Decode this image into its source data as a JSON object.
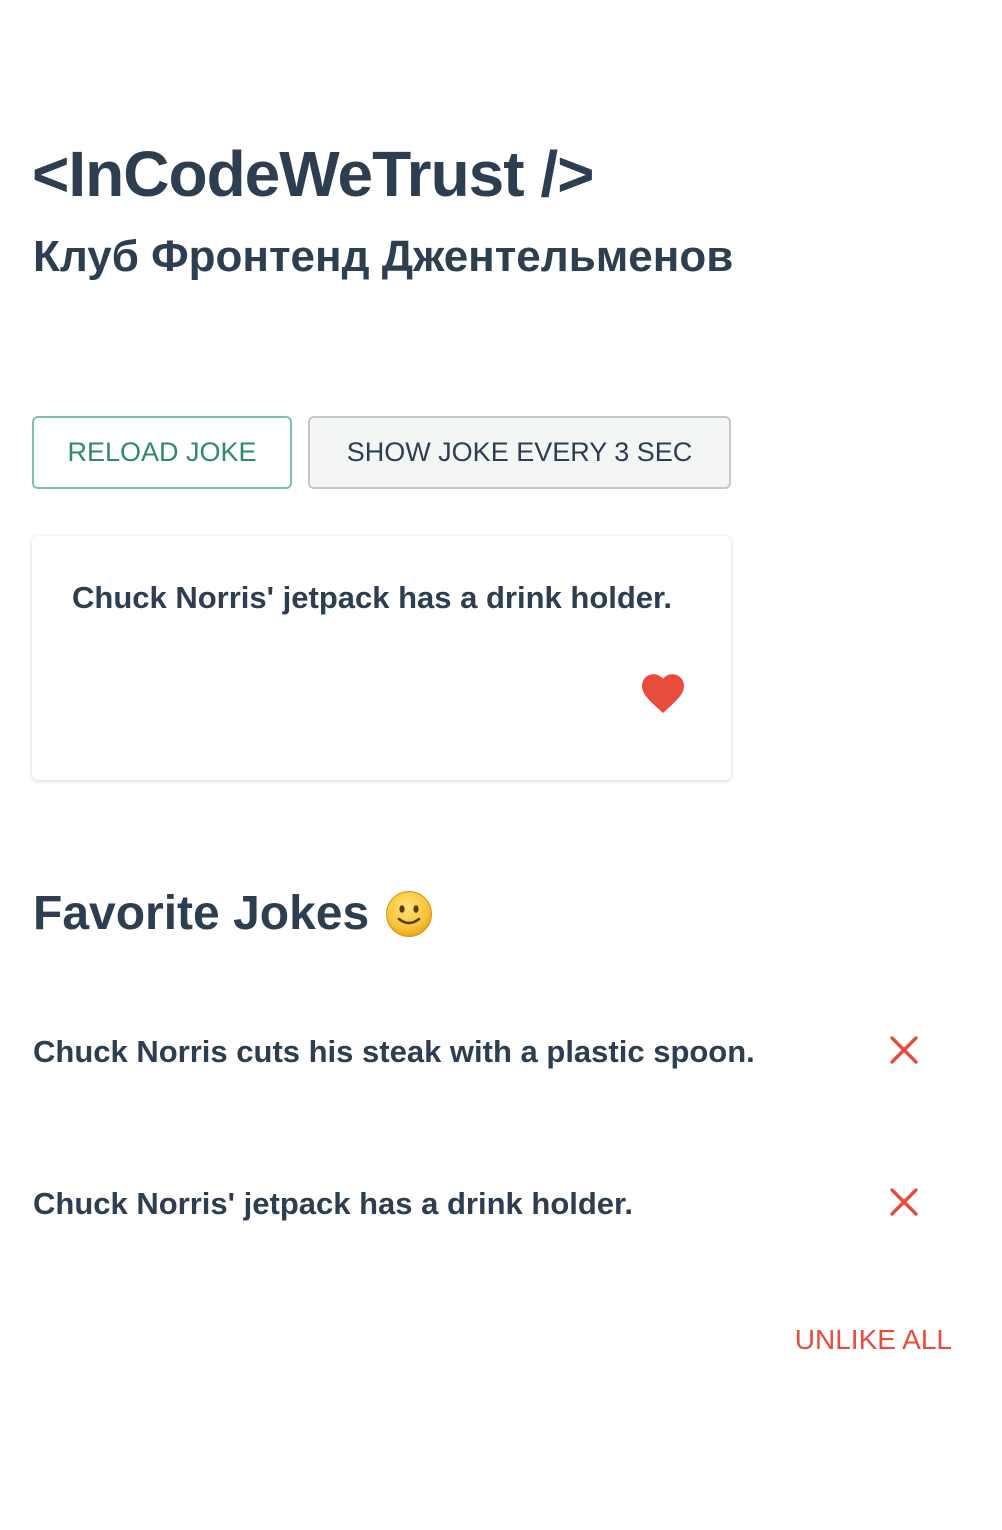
{
  "header": {
    "title": "<InCodeWeTrust />",
    "subtitle": "Клуб Фронтенд Джентельменов"
  },
  "controls": {
    "reload_label": "RELOAD JOKE",
    "interval_label": "SHOW JOKE EVERY 3 SEC"
  },
  "current_joke": {
    "text": "Chuck Norris' jetpack has a drink holder.",
    "liked": true,
    "like_icon": "heart-icon"
  },
  "favorites": {
    "heading": "Favorite Jokes",
    "heading_icon": "slightly-smiling-face",
    "items": [
      {
        "text": "Chuck Norris cuts his steak with a plastic spoon.",
        "remove_icon": "close-icon"
      },
      {
        "text": "Chuck Norris' jetpack has a drink holder.",
        "remove_icon": "close-icon"
      }
    ],
    "unlike_all_label": "UNLIKE ALL"
  },
  "colors": {
    "text": "#2c3e50",
    "accent_green": "#2e8a6c",
    "danger_red": "#e74c3c"
  }
}
